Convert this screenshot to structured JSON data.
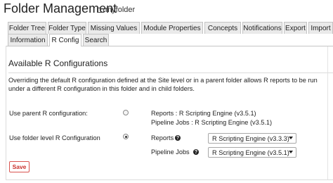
{
  "header": {
    "title": "Folder Management",
    "folder_name": "myfolder",
    "folder_icon": "folder-icon"
  },
  "tabs": [
    {
      "label": "Folder Tree",
      "active": false
    },
    {
      "label": "Folder Type",
      "active": false
    },
    {
      "label": "Missing Values",
      "active": false
    },
    {
      "label": "Module Properties",
      "active": false
    },
    {
      "label": "Concepts",
      "active": false
    },
    {
      "label": "Notifications",
      "active": false
    },
    {
      "label": "Export",
      "active": false
    },
    {
      "label": "Import",
      "active": false
    },
    {
      "label": "Information",
      "active": false
    },
    {
      "label": "R Config",
      "active": true
    },
    {
      "label": "Search",
      "active": false
    }
  ],
  "section": {
    "title": "Available R Configurations",
    "description": "Overriding the default R configuration defined at the Site level or in a parent folder allows R reports to be run under a different R configuration in this folder and in child folders."
  },
  "options": {
    "parent": {
      "label": "Use parent R configuration:",
      "selected": false,
      "reports_text": "Reports : R Scripting Engine (v3.5.1)",
      "pipeline_text": "Pipeline Jobs : R Scripting Engine (v3.5.1)"
    },
    "folder_level": {
      "label": "Use folder level R Configuration",
      "selected": true,
      "reports_label": "Reports",
      "reports_value": "R Scripting Engine (v3.3.3)",
      "pipeline_label": "Pipeline Jobs",
      "pipeline_value": "R Scripting Engine (v3.5.1)",
      "help_icon": "help-icon"
    }
  },
  "actions": {
    "save_label": "Save"
  },
  "colors": {
    "save_text": "#c9302c",
    "save_border": "#d9534f",
    "tab_background": "#eaeaea"
  }
}
